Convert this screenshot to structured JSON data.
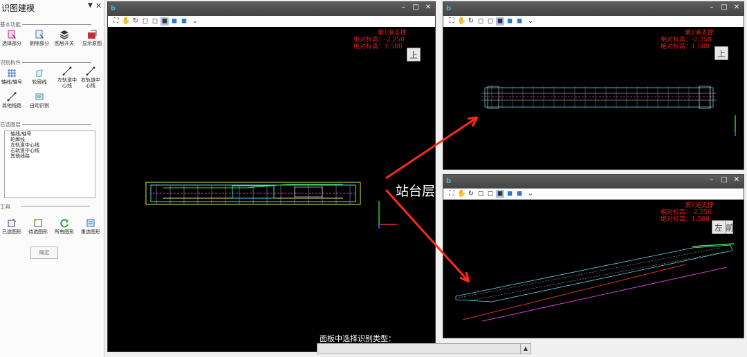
{
  "panel": {
    "title": "识图建模",
    "pin": "▼",
    "close": "✕",
    "sections": {
      "basic": "基本功能",
      "recognize": "识别构件",
      "selected_layers": "已选图层",
      "tools": "工具"
    },
    "basic_tools": [
      "选择部分",
      "剔除部分",
      "图层开关",
      "显示原图"
    ],
    "recognize_tools": [
      "轴线/轴号",
      "轮廓线",
      "左轨道中心线",
      "右轨道中心线",
      "其他线路",
      "自动识别"
    ],
    "layers": [
      "轴线/轴号",
      "轮廓线",
      "左轨道中心线",
      "右轨道中心线",
      "其他线路"
    ],
    "bottom_tools": [
      "已选图形",
      "待选图形",
      "所有图形",
      "重选图形"
    ],
    "ok": "确定"
  },
  "windows": {
    "logo": "b",
    "min": "–",
    "max": "□",
    "close": "✕",
    "info_lines": [
      "第1道支撑",
      "相对标高：-2.250",
      "绝对标高：1.500"
    ],
    "cube_top": "上",
    "cube_left": "左",
    "cube_right": "前"
  },
  "annotation": "站台层",
  "bottom_label": "面板中选择识别类型：",
  "bottom_select_arrow": "▲",
  "colors": {
    "red_text": "#e02020",
    "cyan": "#5fd8e8",
    "yellow": "#e8e840",
    "magenta": "#d040d0",
    "arrow_red": "#ff2a1a"
  }
}
